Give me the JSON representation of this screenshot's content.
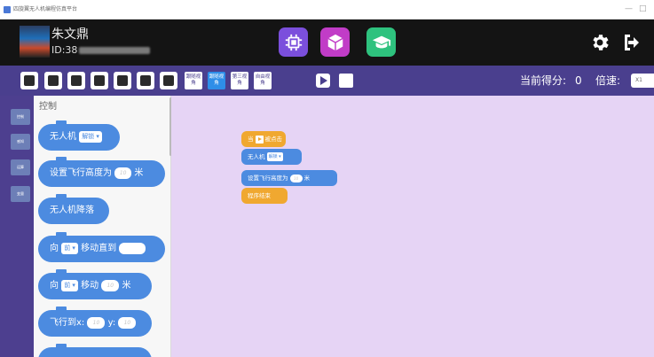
{
  "window": {
    "title": "四旋翼无人机编程仿真平台",
    "minimize_glyph": "—",
    "maximize_glyph": "□"
  },
  "header": {
    "user_name": "朱文鼎",
    "user_id_prefix": "ID:38",
    "buttons": [
      {
        "icon": "chip-icon",
        "color": "#7b4fdc"
      },
      {
        "icon": "cube-icon",
        "color": "#c13cc7"
      },
      {
        "icon": "graduation-cap-icon",
        "color": "#2ec27e"
      }
    ],
    "right_icons": [
      "gear-icon",
      "sign-out-icon"
    ]
  },
  "toolbar": {
    "file_buttons": [
      "open-folder-icon",
      "new-file-icon",
      "save-icon",
      "save-as-icon",
      "copy-icon",
      "paste-icon",
      "delete-icon"
    ],
    "view_buttons": [
      {
        "label": "跟随视角",
        "active": false
      },
      {
        "label": "跟随视角",
        "active": true
      },
      {
        "label": "第三视角",
        "active": false
      },
      {
        "label": "自由视角",
        "active": false
      }
    ],
    "score_label": "当前得分:",
    "score_value": "0",
    "speed_label": "倍速:",
    "speed_value": "X1"
  },
  "categories": [
    "控制",
    "感知",
    "运算",
    "变量"
  ],
  "palette": {
    "heading": "控制",
    "blocks": {
      "drone_prefix": "无人机",
      "drone_mode": "解锁",
      "set_height_prefix": "设置飞行高度为",
      "set_height_placeholder": "10",
      "set_height_unit": "米",
      "land_label": "无人机降落",
      "toward_label": "向",
      "direction": "前",
      "move_until_label": "移动直到",
      "move_label": "移动",
      "move_placeholder": "10",
      "move_unit": "米",
      "fly_to_label": "飞行到x:",
      "fly_to_y_label": "y:",
      "fly_to_x_placeholder": "10",
      "fly_to_y_placeholder": "10"
    }
  },
  "workspace": {
    "start_prefix": "当",
    "start_suffix": "被点击",
    "drone_prefix": "无人机",
    "drone_mode": "解锁",
    "set_height_prefix": "设置飞行高度为",
    "set_height_placeholder": "10",
    "set_height_unit": "米",
    "end_label": "程序结束"
  },
  "colors": {
    "header_bg": "#141414",
    "toolbar_bg": "#4a3f8e",
    "workspace_bg": "#e6d4f5",
    "block_blue": "#4c8be0",
    "block_orange": "#f0a830",
    "active_view": "#2e8ee8"
  }
}
